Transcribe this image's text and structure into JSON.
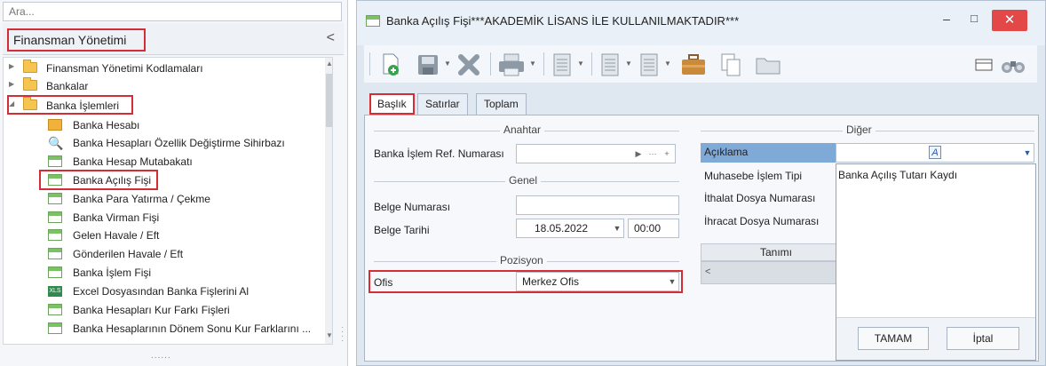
{
  "nav": {
    "search_placeholder": "Ara...",
    "title": "Finansman Yönetimi",
    "collapse_glyph": "<",
    "grip": "......",
    "tree": {
      "folders": [
        {
          "label": "Finansman Yönetimi Kodlamaları",
          "expanded": false
        },
        {
          "label": "Bankalar",
          "expanded": false
        },
        {
          "label": "Banka İşlemleri",
          "expanded": true
        }
      ],
      "items": [
        {
          "label": "Banka Hesabı",
          "icon": "bank-account-icon"
        },
        {
          "label": "Banka Hesapları Özellik Değiştirme Sihirbazı",
          "icon": "wizard-icon"
        },
        {
          "label": "Banka Hesap Mutabakatı",
          "icon": "form-icon"
        },
        {
          "label": "Banka Açılış Fişi",
          "icon": "form-icon",
          "highlighted": true
        },
        {
          "label": "Banka Para Yatırma / Çekme",
          "icon": "form-icon"
        },
        {
          "label": "Banka Virman Fişi",
          "icon": "form-icon"
        },
        {
          "label": "Gelen Havale / Eft",
          "icon": "form-icon"
        },
        {
          "label": "Gönderilen Havale / Eft",
          "icon": "form-icon"
        },
        {
          "label": "Banka İşlem Fişi",
          "icon": "form-icon"
        },
        {
          "label": "Excel Dosyasından Banka Fişlerini Al",
          "icon": "excel-icon"
        },
        {
          "label": "Banka Hesapları Kur Farkı Fişleri",
          "icon": "form-icon"
        },
        {
          "label": "Banka Hesaplarının Dönem Sonu Kur Farklarını ...",
          "icon": "form-icon"
        }
      ]
    }
  },
  "window": {
    "title": "Banka Açılış Fişi***AKADEMİK LİSANS İLE KULLANILMAKTADIR***",
    "controls": {
      "minimize": "–",
      "maximize": "□",
      "close": "✕"
    }
  },
  "toolbar": {
    "icons": [
      "new-document-icon",
      "save-icon",
      "delete-icon",
      "print-icon",
      "report-icon",
      "report-icon",
      "report-icon",
      "briefcase-icon",
      "copy-icon",
      "folder-icon",
      "layout-icon",
      "binoculars-icon"
    ]
  },
  "tabs": [
    {
      "label": "Başlık",
      "active": true
    },
    {
      "label": "Satırlar",
      "active": false
    },
    {
      "label": "Toplam",
      "active": false
    }
  ],
  "form": {
    "anahtar": {
      "title": "Anahtar",
      "ref_label": "Banka İşlem Ref. Numarası",
      "ref_value": ""
    },
    "genel": {
      "title": "Genel",
      "belge_no_label": "Belge Numarası",
      "belge_no_value": "",
      "belge_tarihi_label": "Belge Tarihi",
      "belge_tarihi_value": "18.05.2022",
      "saat_value": "00:00"
    },
    "pozisyon": {
      "title": "Pozisyon",
      "ofis_label": "Ofis",
      "ofis_value": "Merkez Ofis"
    },
    "diger": {
      "title": "Diğer",
      "rows": [
        "Açıklama",
        "Muhasebe İşlem Tipi",
        "İthalat Dosya Numarası",
        "İhracat Dosya Numarası"
      ],
      "grid_header": "Tanımı"
    }
  },
  "dropdown": {
    "text": "Banka Açılış Tutarı Kaydı",
    "ok_label": "TAMAM",
    "cancel_label": "İptal"
  },
  "colors": {
    "highlight": "#d42d35",
    "selection": "#7fa9d6",
    "close": "#e24848",
    "folder": "#f5c451",
    "form_icon": "#7bc267"
  }
}
